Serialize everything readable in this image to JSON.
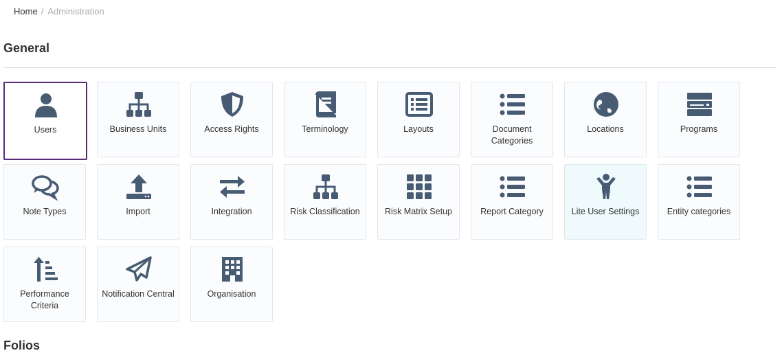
{
  "breadcrumb": {
    "home": "Home",
    "separator": "/",
    "current": "Administration"
  },
  "sections": {
    "general": "General",
    "folios": "Folios"
  },
  "colors": {
    "icon": "#475b73",
    "selected_border": "#5a2a7a",
    "tile_bg": "#fbfcfd",
    "highlight_bg": "#eefafc"
  },
  "tiles": [
    {
      "label": "Users",
      "icon": "user-icon"
    },
    {
      "label": "Business Units",
      "icon": "sitemap-icon"
    },
    {
      "label": "Access Rights",
      "icon": "shield-icon"
    },
    {
      "label": "Terminology",
      "icon": "book-icon"
    },
    {
      "label": "Layouts",
      "icon": "list-alt-icon"
    },
    {
      "label": "Document Categories",
      "icon": "list-icon"
    },
    {
      "label": "Locations",
      "icon": "globe-icon"
    },
    {
      "label": "Programs",
      "icon": "server-icon"
    },
    {
      "label": "Note Types",
      "icon": "comments-icon"
    },
    {
      "label": "Import",
      "icon": "upload-icon"
    },
    {
      "label": "Integration",
      "icon": "exchange-icon"
    },
    {
      "label": "Risk Classification",
      "icon": "sitemap-icon"
    },
    {
      "label": "Risk Matrix Setup",
      "icon": "grid-icon"
    },
    {
      "label": "Report Category",
      "icon": "list-icon"
    },
    {
      "label": "Lite User Settings",
      "icon": "child-icon"
    },
    {
      "label": "Entity categories",
      "icon": "list-icon"
    },
    {
      "label": "Performance Criteria",
      "icon": "sort-amount-icon"
    },
    {
      "label": "Notification Central",
      "icon": "paper-plane-icon"
    },
    {
      "label": "Organisation",
      "icon": "building-icon"
    }
  ]
}
